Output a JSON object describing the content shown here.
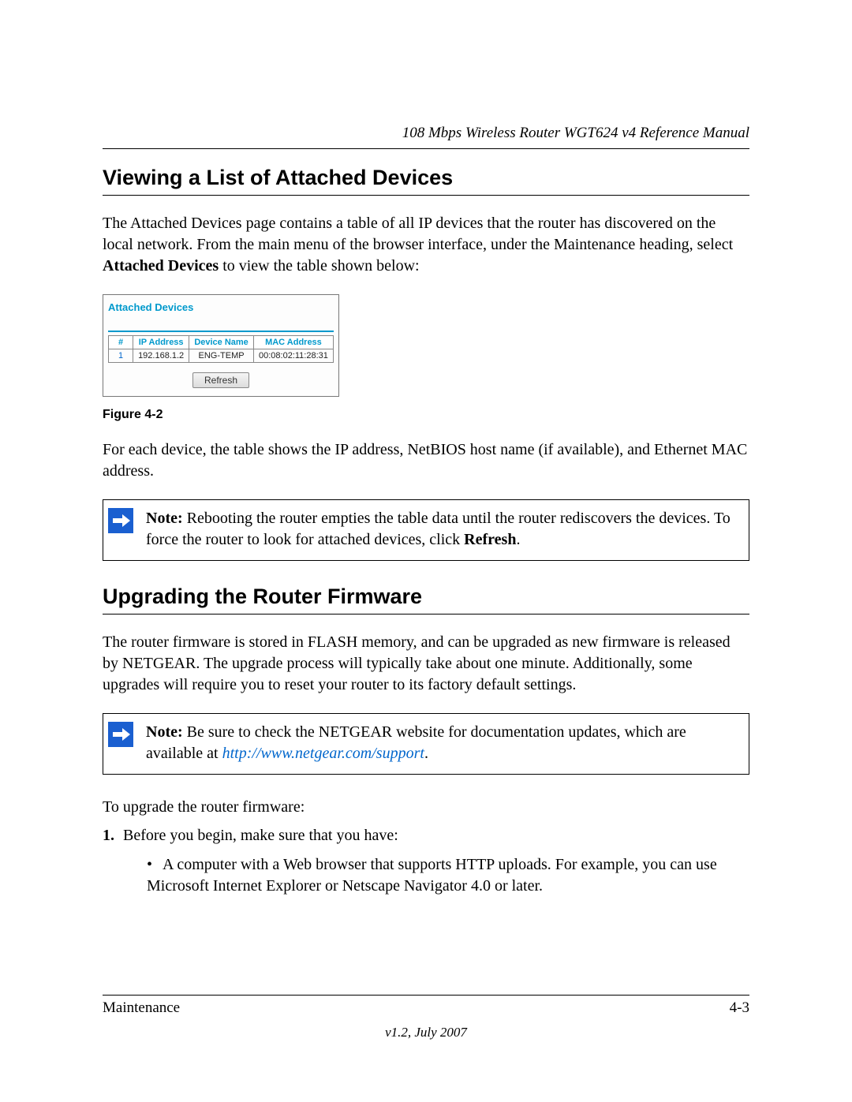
{
  "header": {
    "running_head": "108 Mbps Wireless Router WGT624 v4 Reference Manual"
  },
  "section1": {
    "heading": "Viewing a List of Attached Devices",
    "para1_a": "The Attached Devices page contains a table of all IP devices that the router has discovered on the local network. From the main menu of the browser interface, under the Maintenance heading, select ",
    "para1_bold": "Attached Devices",
    "para1_b": " to view the table shown below:",
    "figure_caption": "Figure 4-2",
    "para2": "For each device, the table shows the IP address, NetBIOS host name (if available), and Ethernet MAC address.",
    "note_label": "Note:",
    "note_a": " Rebooting the router empties the table data until the router rediscovers the devices. To force the router to look for attached devices, click ",
    "note_bold": "Refresh",
    "note_b": "."
  },
  "screenshot": {
    "title": "Attached Devices",
    "col_num": "#",
    "col_ip": "IP Address",
    "col_name": "Device Name",
    "col_mac": "MAC Address",
    "row_num": "1",
    "row_ip": "192.168.1.2",
    "row_name": "ENG-TEMP",
    "row_mac": "00:08:02:11:28:31",
    "refresh": "Refresh"
  },
  "section2": {
    "heading": "Upgrading the Router Firmware",
    "para1": "The router firmware is stored in FLASH memory, and can be upgraded as new firmware is released by NETGEAR. The upgrade process will typically take about one minute. Additionally, some upgrades will require you to reset your router to its factory default settings.",
    "note_label": "Note:",
    "note_a": " Be sure to check the NETGEAR website for documentation updates, which are available at ",
    "note_link_text": "http://www.netgear.com/support",
    "note_b": ".",
    "intro": "To upgrade the router firmware:",
    "step1_num": "1.",
    "step1_text": "Before you begin, make sure that you have:",
    "bullet1": "A computer with a Web browser that supports HTTP uploads. For example, you can use Microsoft Internet Explorer or Netscape Navigator 4.0 or later."
  },
  "footer": {
    "left": "Maintenance",
    "right": "4-3",
    "version": "v1.2, July 2007"
  }
}
